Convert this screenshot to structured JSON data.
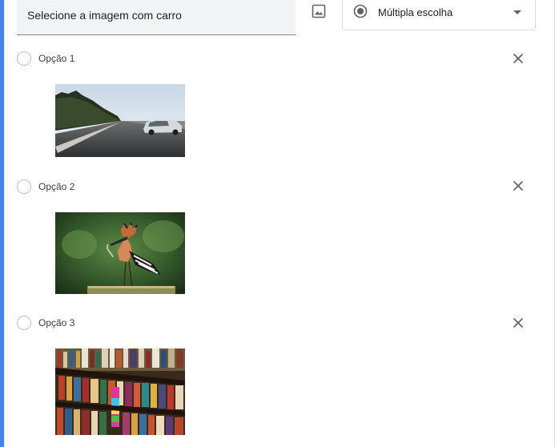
{
  "question": {
    "title": "Selecione a imagem com carro"
  },
  "type_selector": {
    "selected": "Múltipla escolha",
    "icon": "radio-checked-icon"
  },
  "options": [
    {
      "label": "Opção 1",
      "image": "car-on-road-image"
    },
    {
      "label": "Opção 2",
      "image": "hoopoe-bird-image"
    },
    {
      "label": "Opção 3",
      "image": "bookshelf-image"
    }
  ],
  "colors": {
    "accent_blue": "#4285f4",
    "accent_purple": "#673ab7",
    "icon_gray": "#5f6368"
  }
}
